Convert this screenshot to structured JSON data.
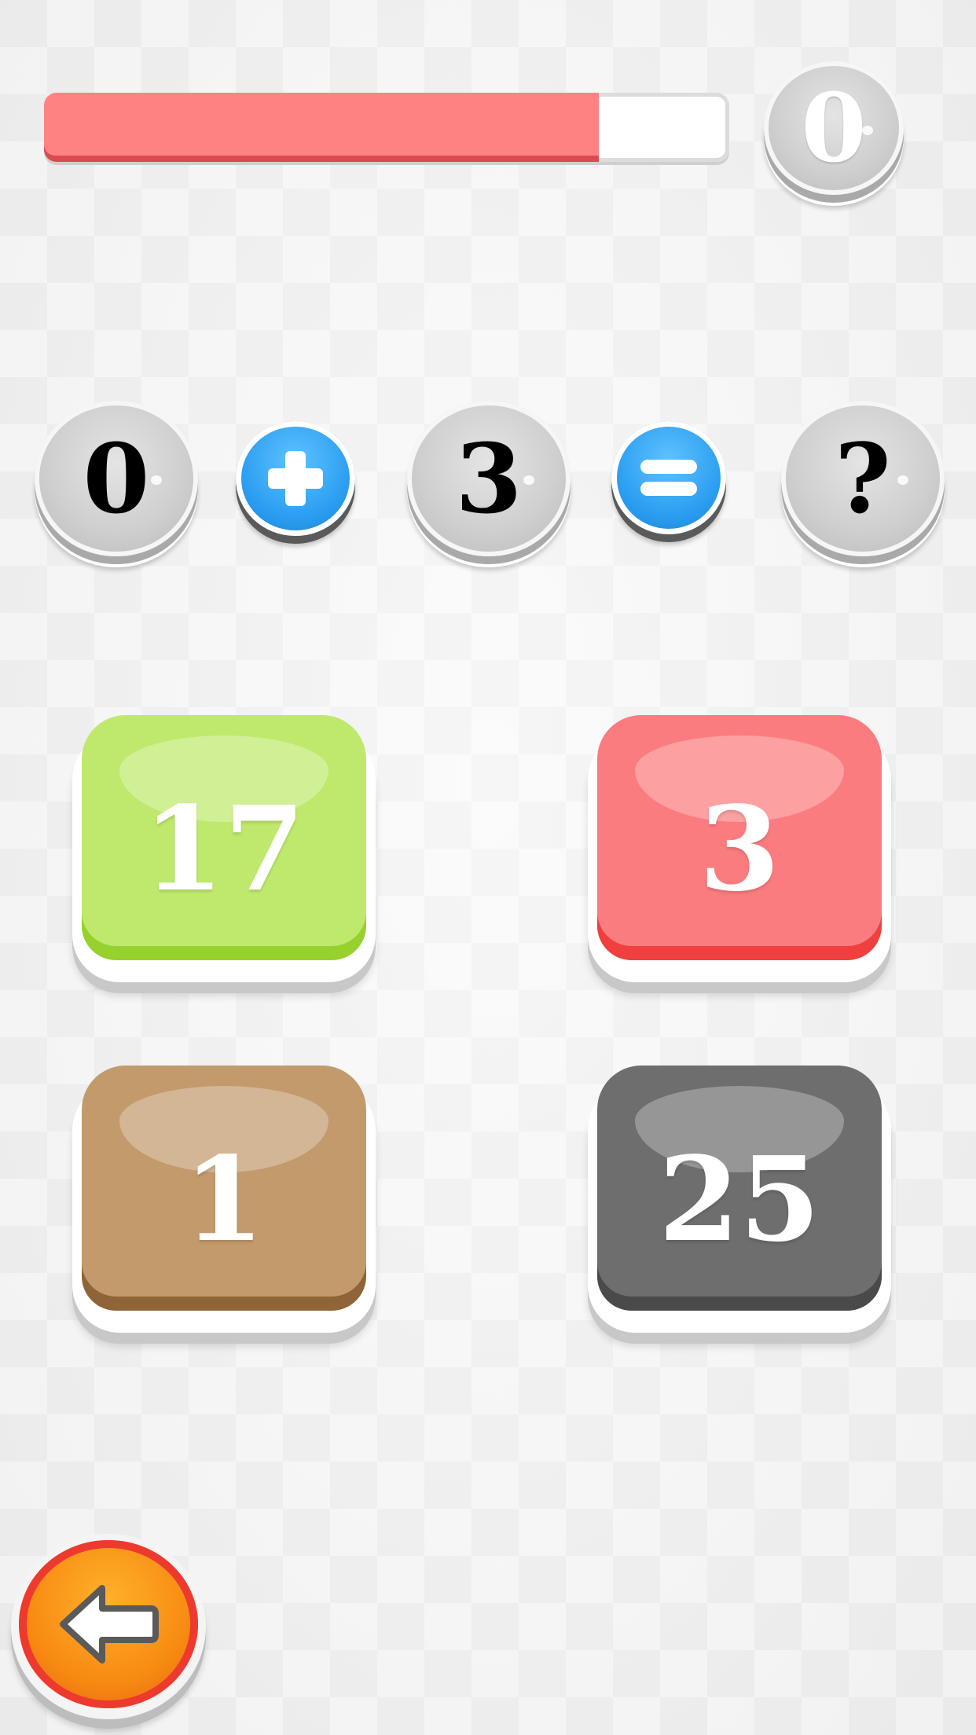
{
  "timer": {
    "remaining_fraction": 0.81,
    "fill_color": "#ff8283"
  },
  "score": {
    "value": "0"
  },
  "equation": {
    "operand_a": "0",
    "operator": "plus-icon",
    "operand_b": "3",
    "equals": "equals-icon",
    "result": "?"
  },
  "answers": [
    {
      "value": "17",
      "color": "#bfe96c",
      "shade": "#96d12e"
    },
    {
      "value": "3",
      "color": "#fb7c7f",
      "shade": "#ef3f3f"
    },
    {
      "value": "1",
      "color": "#c29a6c",
      "shade": "#8f6538"
    },
    {
      "value": "25",
      "color": "#6e6e6e",
      "shade": "#4a4a4a"
    }
  ],
  "back_button": {
    "icon": "arrow-left-icon",
    "color": "#f78a12"
  }
}
